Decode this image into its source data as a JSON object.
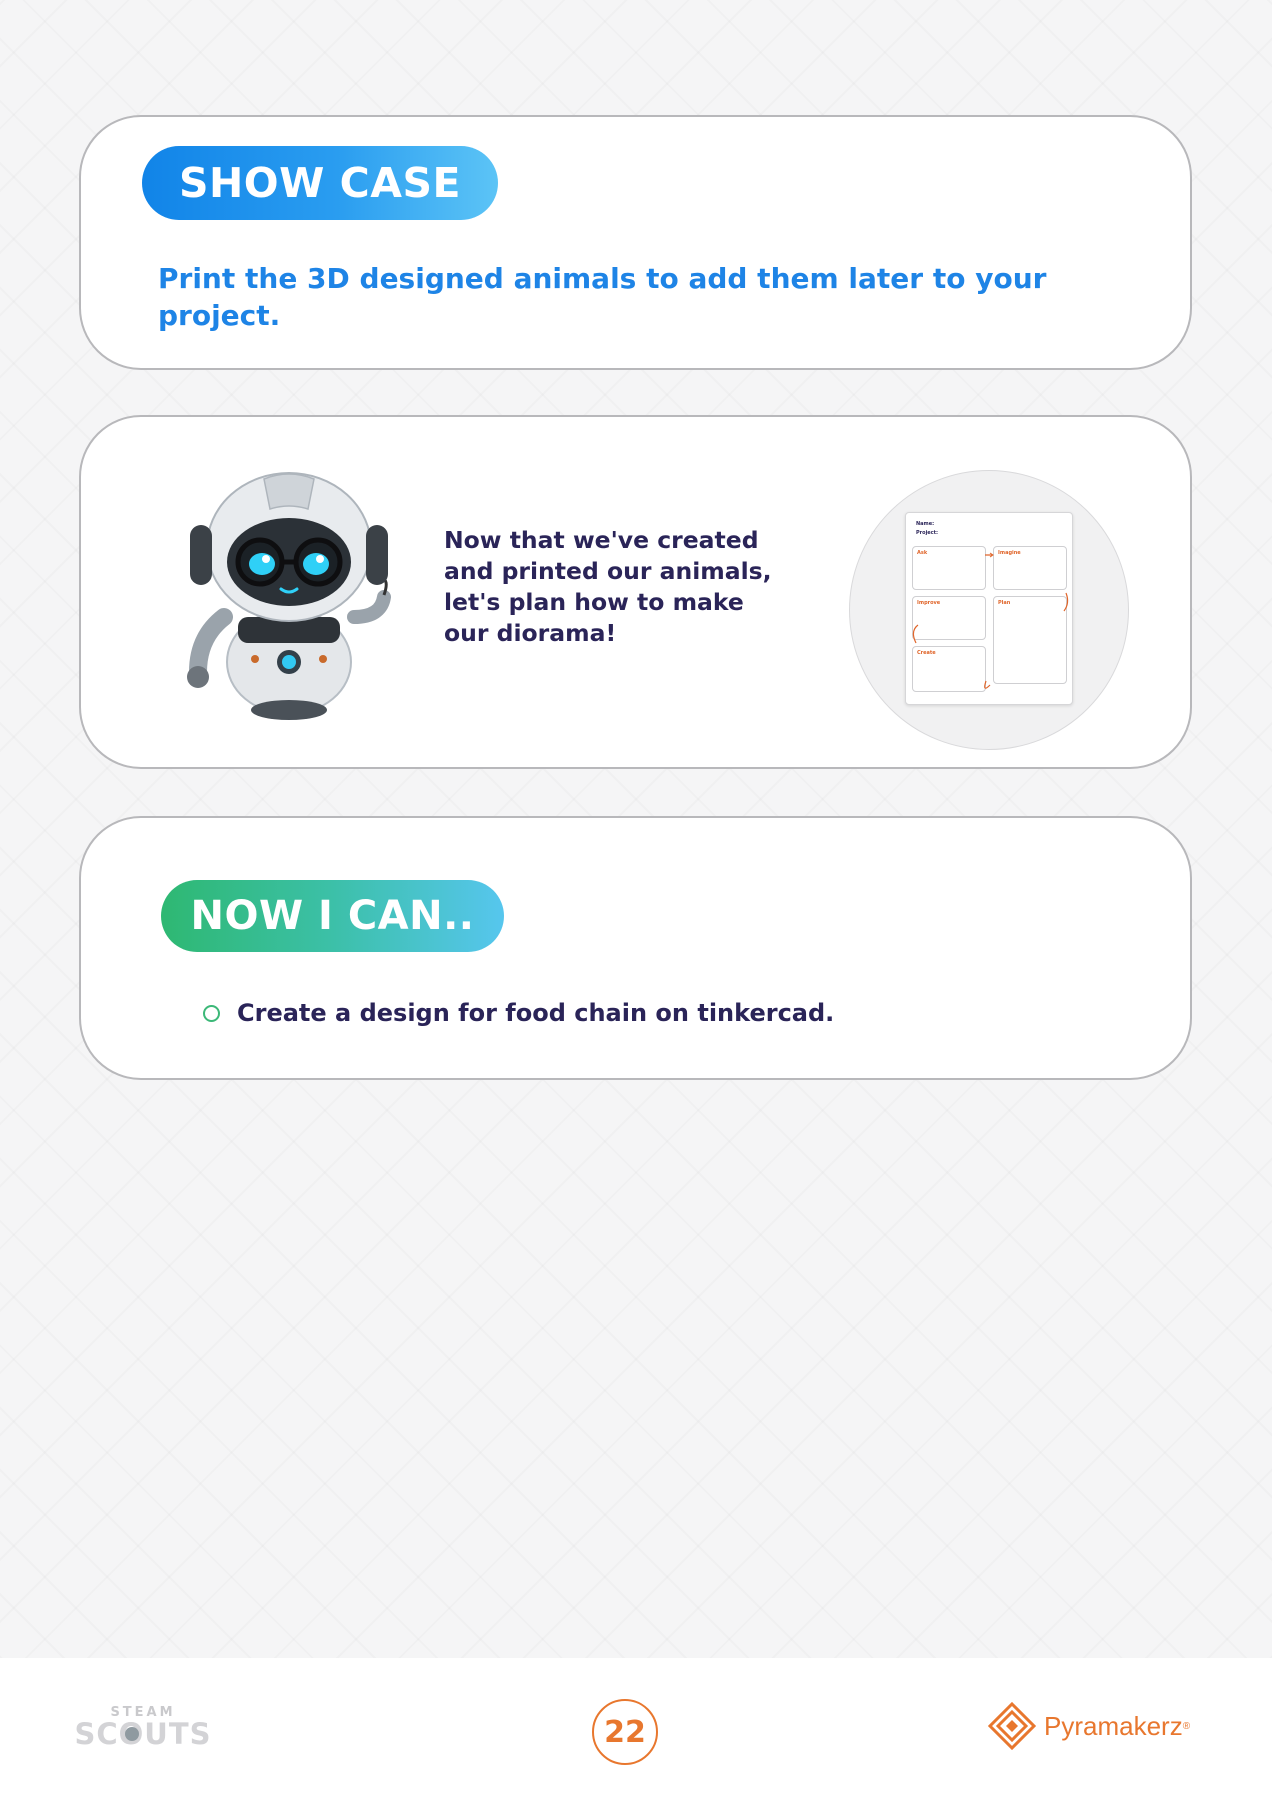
{
  "showcase": {
    "heading": "SHOW CASE",
    "text": "Print the 3D designed animals to add them later to your project."
  },
  "plan": {
    "text": "Now that we've created and printed our animals, let's plan how to make our diorama!",
    "worksheet": {
      "name_label": "Name:",
      "project_label": "Project:",
      "boxes": [
        "Ask",
        "Imagine",
        "Improve",
        "Plan",
        "Create"
      ]
    }
  },
  "now_i_can": {
    "heading": "NOW I CAN..",
    "items": [
      "Create a design for food chain on tinkercad."
    ]
  },
  "footer": {
    "brand_left_top": "STEAM",
    "brand_left_bottom": "SCOUTS",
    "page_number": "22",
    "brand_right": "Pyramakerz",
    "brand_right_mark": "®"
  },
  "colors": {
    "showcase_blue": "#1e84e6",
    "nowican_green": "#2eb872",
    "text_navy": "#2a2458",
    "accent_orange": "#e8772e"
  }
}
